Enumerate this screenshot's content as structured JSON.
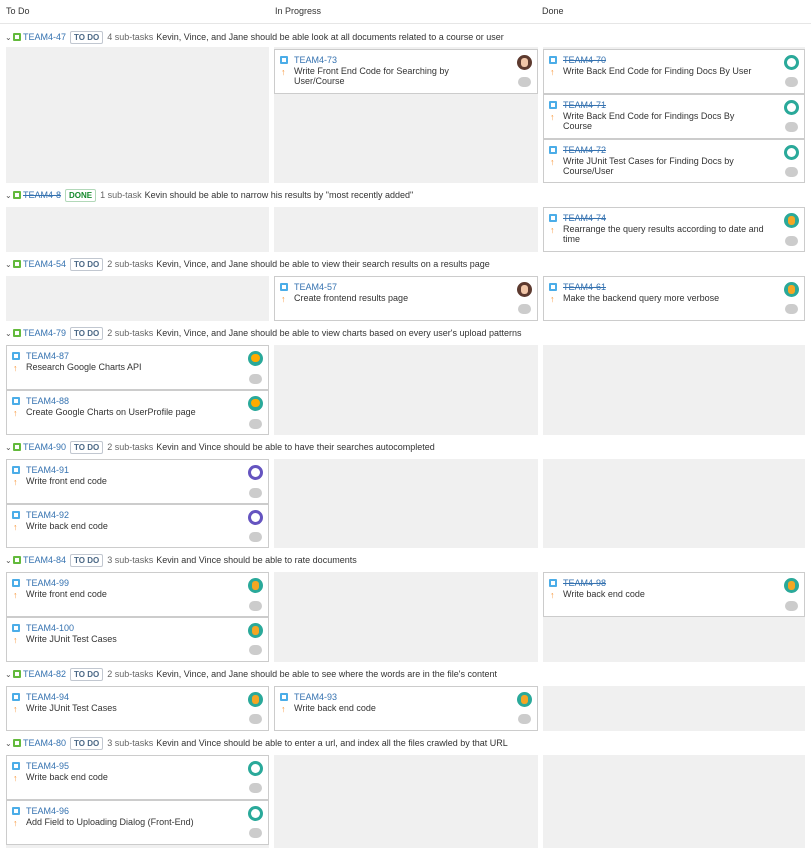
{
  "columns": [
    "To Do",
    "In Progress",
    "Done"
  ],
  "swimlanes": [
    {
      "key": "TEAM4-47",
      "status": "TO DO",
      "subtasks": "4 sub-tasks",
      "summary": "Kevin, Vince, and Jane should be able look at all documents related to a course or user"
    },
    {
      "key": "TEAM4-8",
      "status": "DONE",
      "subtasks": "1 sub-task",
      "summary": "Kevin should be able to narrow his results by \"most recently added\""
    },
    {
      "key": "TEAM4-54",
      "status": "TO DO",
      "subtasks": "2 sub-tasks",
      "summary": "Kevin, Vince, and Jane should be able to view their search results on a results page"
    },
    {
      "key": "TEAM4-79",
      "status": "TO DO",
      "subtasks": "2 sub-tasks",
      "summary": "Kevin, Vince, and Jane should be able to view charts based on every user's upload patterns"
    },
    {
      "key": "TEAM4-90",
      "status": "TO DO",
      "subtasks": "2 sub-tasks",
      "summary": "Kevin and Vince should be able to have their searches autocompleted"
    },
    {
      "key": "TEAM4-84",
      "status": "TO DO",
      "subtasks": "3 sub-tasks",
      "summary": "Kevin and Vince should be able to rate documents"
    },
    {
      "key": "TEAM4-82",
      "status": "TO DO",
      "subtasks": "2 sub-tasks",
      "summary": "Kevin, Vince, and Jane should be able to see where the words are in the file's content"
    },
    {
      "key": "TEAM4-80",
      "status": "TO DO",
      "subtasks": "3 sub-tasks",
      "summary": "Kevin and Vince should be able to enter a url, and index all the files crawled by that URL"
    }
  ],
  "cards": [
    {
      "key": "TEAM4-73",
      "title": "Write Front End Code for Searching by User/Course",
      "avatar": "face-avatar",
      "done": false
    },
    {
      "key": "TEAM4-70",
      "title": "Write Back End Code for Finding Docs By User",
      "avatar": "robot-avatar",
      "done": true
    },
    {
      "key": "TEAM4-71",
      "title": "Write Back End Code for Findings Docs By Course",
      "avatar": "robot-avatar",
      "done": true
    },
    {
      "key": "TEAM4-72",
      "title": "Write JUnit Test Cases for Finding Docs by Course/User",
      "avatar": "robot-avatar",
      "done": true
    },
    {
      "key": "TEAM4-74",
      "title": "Rearrange the query results according to date and time",
      "avatar": "dog-avatar",
      "done": true
    },
    {
      "key": "TEAM4-57",
      "title": "Create frontend results page",
      "avatar": "face-avatar",
      "done": false
    },
    {
      "key": "TEAM4-61",
      "title": "Make the backend query more verbose",
      "avatar": "dog-avatar",
      "done": true
    },
    {
      "key": "TEAM4-87",
      "title": "Research Google Charts API",
      "avatar": "monkey-avatar",
      "done": false
    },
    {
      "key": "TEAM4-88",
      "title": "Create Google Charts on UserProfile page",
      "avatar": "monkey-avatar",
      "done": false
    },
    {
      "key": "TEAM4-91",
      "title": "Write front end code",
      "avatar": "skull-avatar",
      "done": false
    },
    {
      "key": "TEAM4-92",
      "title": "Write back end code",
      "avatar": "skull-avatar",
      "done": false
    },
    {
      "key": "TEAM4-99",
      "title": "Write front end code",
      "avatar": "dog-avatar",
      "done": false
    },
    {
      "key": "TEAM4-98",
      "title": "Write back end code",
      "avatar": "dog-avatar",
      "done": true
    },
    {
      "key": "TEAM4-100",
      "title": "Write JUnit Test Cases",
      "avatar": "dog-avatar",
      "done": false
    },
    {
      "key": "TEAM4-94",
      "title": "Write JUnit Test Cases",
      "avatar": "dog-avatar",
      "done": false
    },
    {
      "key": "TEAM4-93",
      "title": "Write back end code",
      "avatar": "dog-avatar",
      "done": false
    },
    {
      "key": "TEAM4-95",
      "title": "Write back end code",
      "avatar": "robot-avatar",
      "done": false
    },
    {
      "key": "TEAM4-96",
      "title": "Add Field to Uploading Dialog (Front-End)",
      "avatar": "robot-avatar",
      "done": false
    }
  ]
}
